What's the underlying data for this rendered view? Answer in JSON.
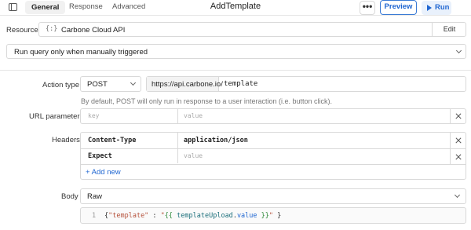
{
  "tabs": {
    "general": "General",
    "response": "Response",
    "advanced": "Advanced"
  },
  "title": "AddTemplate",
  "toolbar": {
    "more": "•••",
    "preview": "Preview",
    "run": "Run"
  },
  "resource": {
    "label": "Resource",
    "icon_glyph": "{:}",
    "value": "Carbone Cloud API",
    "edit": "Edit"
  },
  "trigger": {
    "value": "Run query only when manually triggered"
  },
  "action": {
    "label": "Action type",
    "method": "POST",
    "base_url": "https://api.carbone.io/",
    "path": "template",
    "hint": "By default, POST will only run in response to a user interaction (i.e. button click)."
  },
  "url_params": {
    "label": "URL parameters",
    "key_placeholder": "key",
    "value_placeholder": "value"
  },
  "headers": {
    "label": "Headers",
    "rows": [
      {
        "key": "Content-Type",
        "value": "application/json"
      },
      {
        "key": "Expect",
        "value": ""
      }
    ],
    "value_placeholder": "value",
    "add_new": "+ Add new"
  },
  "body": {
    "label": "Body",
    "type": "Raw",
    "line_number": "1",
    "code": {
      "open": "{",
      "key": "\"template\"",
      "colon": " : ",
      "q1": "\"",
      "expr_open": "{{ ",
      "expr_obj": "templateUpload",
      "expr_dot": ".",
      "expr_prop": "value",
      "expr_close": " }}",
      "q2": "\"",
      "close": " }"
    }
  },
  "colors": {
    "accent": "#1f66d1",
    "string": "#b5503a",
    "expr": "#2f8a3a",
    "key": "#b5503a"
  }
}
